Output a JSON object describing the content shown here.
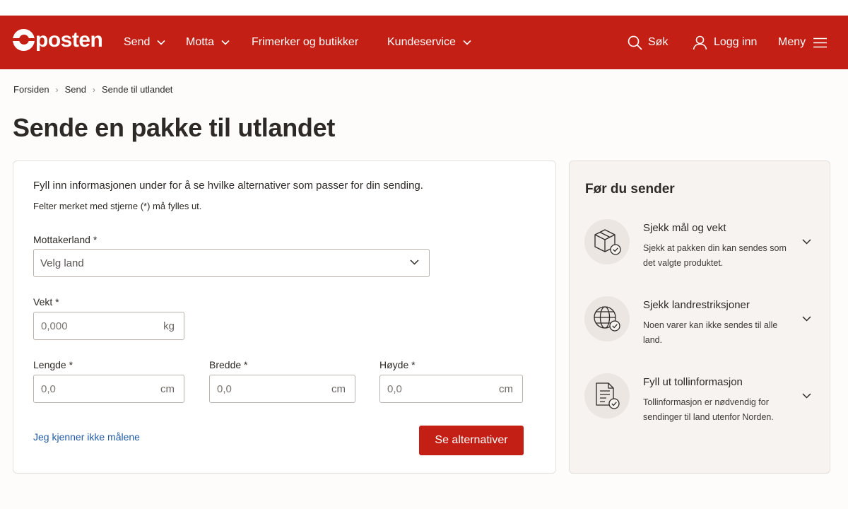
{
  "brand": {
    "name": "posten",
    "color": "#c31f14"
  },
  "nav": {
    "send": "Send",
    "motta": "Motta",
    "frimerker": "Frimerker og butikker",
    "kundeservice": "Kundeservice",
    "search": "Søk",
    "login": "Logg inn",
    "menu": "Meny"
  },
  "breadcrumb": [
    "Forsiden",
    "Send",
    "Sende til utlandet"
  ],
  "page_title": "Sende en pakke til utlandet",
  "form": {
    "intro": "Fyll inn informasjonen under for å se hvilke alternativer som passer for din sending.",
    "note": "Felter merket med stjerne (*) må fylles ut.",
    "country_label": "Mottakerland *",
    "country_placeholder": "Velg land",
    "weight_label": "Vekt *",
    "weight_placeholder": "0,000",
    "weight_unit": "kg",
    "length_label": "Lengde *",
    "width_label": "Bredde *",
    "height_label": "Høyde *",
    "dim_placeholder": "0,0",
    "dim_unit": "cm",
    "unknown_link": "Jeg kjenner ikke målene",
    "submit": "Se alternativer"
  },
  "sidebar": {
    "title": "Før du sender",
    "items": [
      {
        "icon": "package-check-icon",
        "title": "Sjekk mål og vekt",
        "desc": "Sjekk at pakken din kan sendes som det valgte produktet."
      },
      {
        "icon": "globe-check-icon",
        "title": "Sjekk landrestriksjoner",
        "desc": "Noen varer kan ikke sendes til alle land."
      },
      {
        "icon": "document-check-icon",
        "title": "Fyll ut tollinformasjon",
        "desc": "Tollinformasjon er nødvendig for sendinger til land utenfor Norden."
      }
    ]
  }
}
